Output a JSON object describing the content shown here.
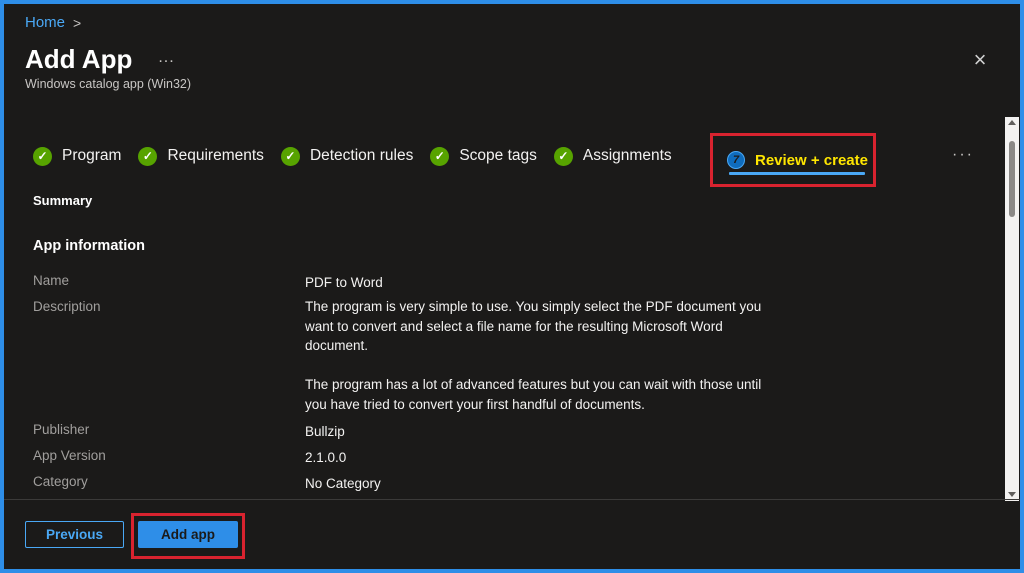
{
  "breadcrumb": {
    "home": "Home",
    "separator": ">"
  },
  "header": {
    "title": "Add App",
    "more": "...",
    "subtitle": "Windows catalog app (Win32)",
    "close": "×"
  },
  "tabs": [
    {
      "label": "Program",
      "state": "complete"
    },
    {
      "label": "Requirements",
      "state": "complete"
    },
    {
      "label": "Detection rules",
      "state": "complete"
    },
    {
      "label": "Scope tags",
      "state": "complete"
    },
    {
      "label": "Assignments",
      "state": "complete"
    },
    {
      "label": "Review + create",
      "state": "active",
      "step": "7"
    }
  ],
  "tabs_more": "···",
  "summary": {
    "heading": "Summary",
    "app_info_heading": "App information",
    "rows": [
      {
        "label": "Name",
        "value": "PDF to Word"
      },
      {
        "label": "Description",
        "value": "The program is very simple to use. You simply select the PDF document you want to convert and select a file name for the resulting Microsoft Word document.",
        "value2": "The program has a lot of advanced features but you can wait with those until you have tried to convert your first handful of documents."
      },
      {
        "label": "Publisher",
        "value": "Bullzip"
      },
      {
        "label": "App Version",
        "value": "2.1.0.0"
      },
      {
        "label": "Category",
        "value": "No Category"
      }
    ]
  },
  "footer": {
    "previous_label": "Previous",
    "add_label": "Add app"
  },
  "colors": {
    "accent": "#2e8ee8",
    "check": "#57a300",
    "highlight_border": "#d9232f",
    "active_tab_text": "#ffe600"
  }
}
